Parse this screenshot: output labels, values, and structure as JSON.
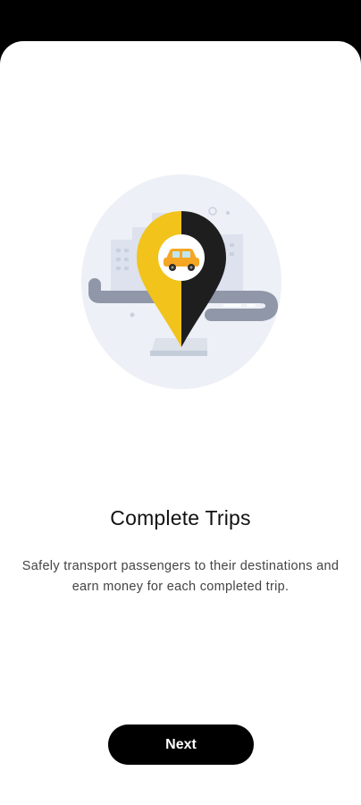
{
  "onboarding": {
    "title": "Complete Trips",
    "description": "Safely transport passengers to their destinations and earn money for each completed trip.",
    "next_label": "Next",
    "illustration_icons": [
      "location-pin-icon",
      "car-icon"
    ]
  },
  "colors": {
    "status_bar": "#000000",
    "background": "#ffffff",
    "accent_yellow": "#F2C31B",
    "pin_dark": "#1E1E1E",
    "button": "#000000",
    "button_text": "#ffffff",
    "illustration_bg": "#EDF0F6",
    "road": "#8F97A8",
    "car": "#F5A623"
  }
}
